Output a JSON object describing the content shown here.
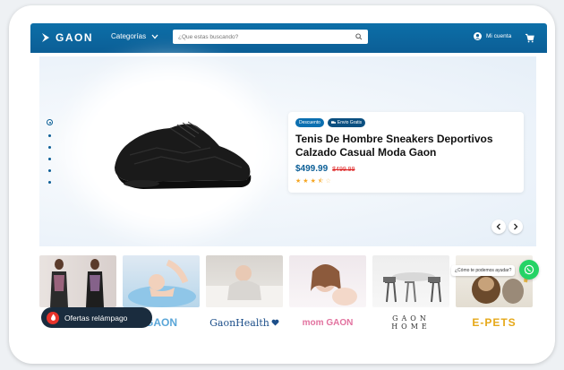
{
  "header": {
    "logo_text": "GAON",
    "categories_label": "Categorías",
    "search_placeholder": "¿Que estas buscando?",
    "account_label": "Mi cuenta"
  },
  "hero": {
    "badge_discount": "Descuento",
    "badge_shipping": "Envio Gratis",
    "product_title": "Tenis De Hombre Sneakers Deportivos Calzado Casual Moda Gaon",
    "price": "$499.99",
    "old_price": "$499.99",
    "rating": 3.5,
    "rating_max": 5,
    "slides": 6,
    "active_slide": 1
  },
  "brands": [
    {
      "name": "fashion-brand",
      "label": ""
    },
    {
      "name": "baby-brand",
      "label": "GAON"
    },
    {
      "name": "gaon-health",
      "label": "GaonHealth"
    },
    {
      "name": "mom-gaon",
      "label": "mom GAON"
    },
    {
      "name": "gaon-home",
      "label": "GAON HOME"
    },
    {
      "name": "e-pets",
      "label": "E-PETS"
    }
  ],
  "flash": {
    "label": "Ofertas relámpago"
  },
  "whatsapp": {
    "bubble": "¿Cómo te podemos ayudar?"
  },
  "colors": {
    "brand": "#0b5e96",
    "accent": "#0b6fb0",
    "sale": "#dd2222",
    "flash": "#1a2c3e",
    "star": "#f5a623"
  }
}
